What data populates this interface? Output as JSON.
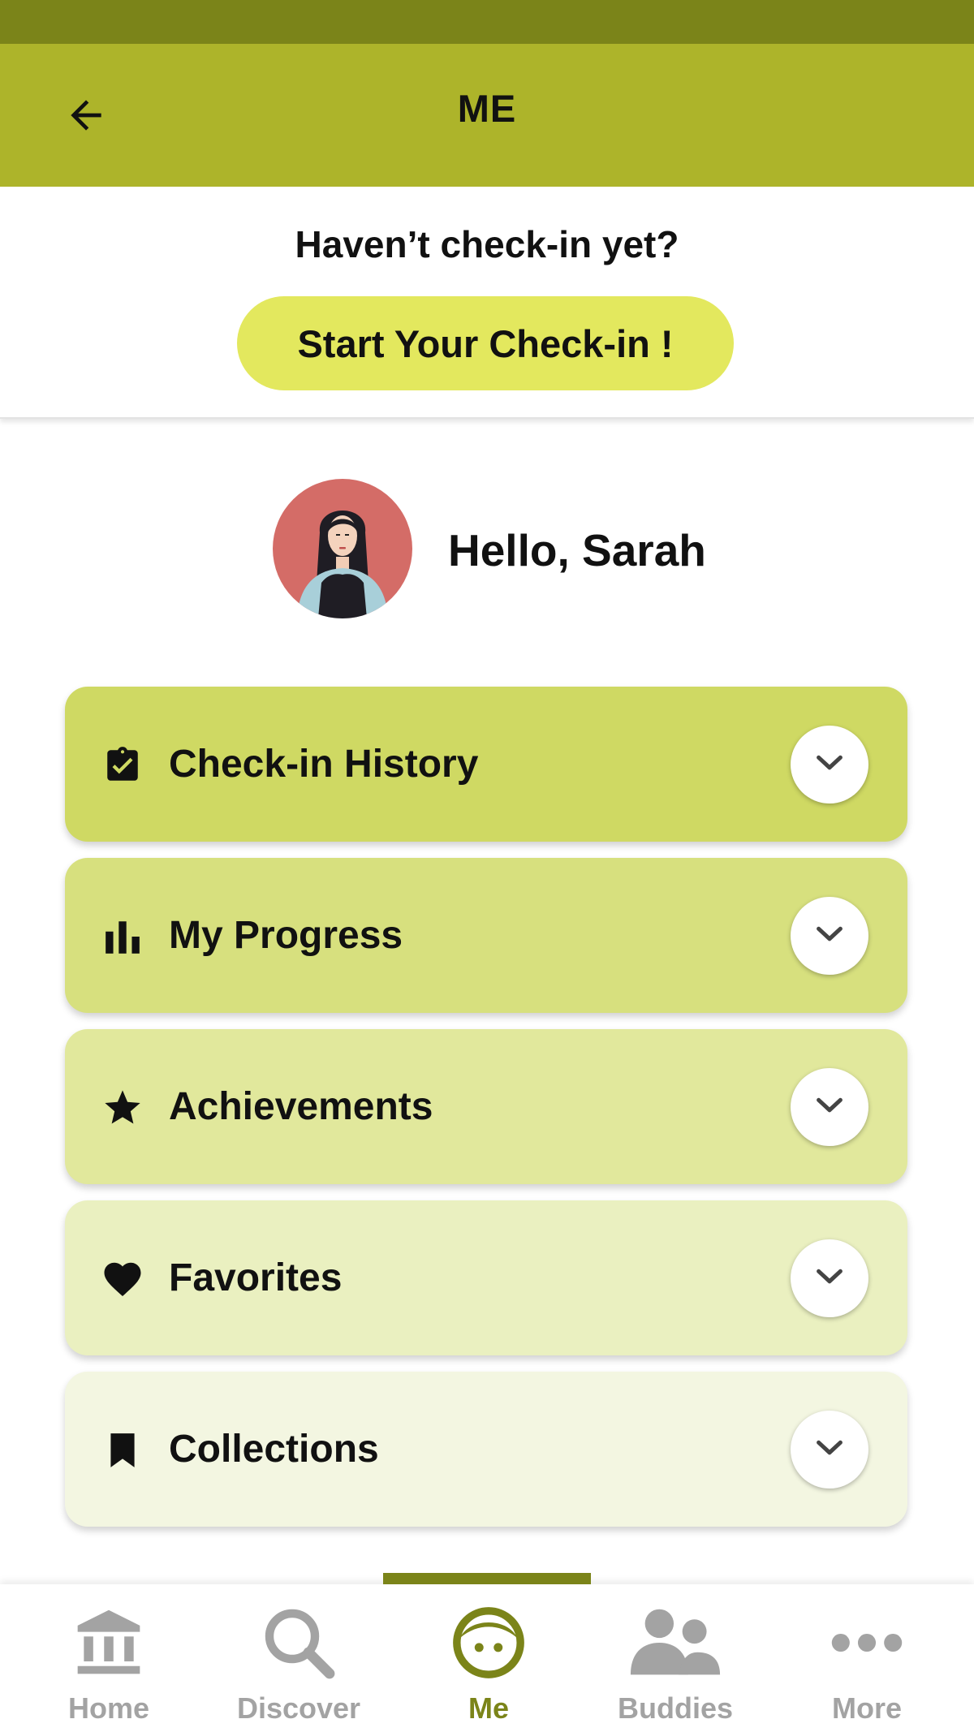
{
  "app_bar": {
    "title": "ME",
    "back_icon": "arrow-left-icon"
  },
  "checkin": {
    "question": "Haven’t check-in yet?",
    "button_label": "Start Your Check-in !",
    "button_color": "#e3e85e"
  },
  "profile": {
    "greeting": "Hello, Sarah",
    "avatar_bg": "#d46c67"
  },
  "menu": {
    "items": [
      {
        "label": "Check-in History",
        "icon": "clipboard-check-icon",
        "color": "#cfd963"
      },
      {
        "label": "My Progress",
        "icon": "bar-chart-icon",
        "color": "#d7e07e"
      },
      {
        "label": "Achievements",
        "icon": "star-icon",
        "color": "#e1e89c"
      },
      {
        "label": "Favorites",
        "icon": "heart-icon",
        "color": "#eaf0c0"
      },
      {
        "label": "Collections",
        "icon": "bookmark-icon",
        "color": "#f3f6e1"
      }
    ],
    "chevron_icon": "chevron-down-icon"
  },
  "bottom_nav": {
    "items": [
      {
        "label": "Home",
        "icon": "bank-icon"
      },
      {
        "label": "Discover",
        "icon": "search-icon"
      },
      {
        "label": "Me",
        "icon": "face-icon"
      },
      {
        "label": "Buddies",
        "icon": "people-icon"
      },
      {
        "label": "More",
        "icon": "more-dots-icon"
      }
    ],
    "active": "Me",
    "active_color": "#7b8419",
    "inactive_color": "#a3a3a3"
  },
  "colors": {
    "status_bar": "#7b8419",
    "app_bar": "#adb42a"
  }
}
